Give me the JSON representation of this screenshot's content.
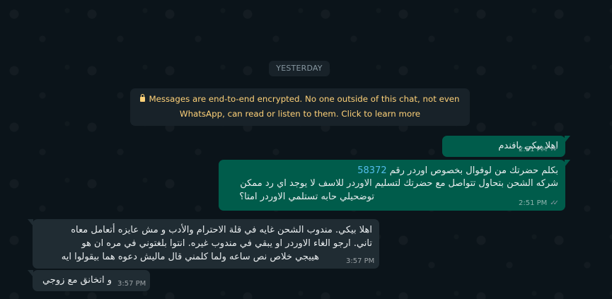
{
  "date_chip": "YESTERDAY",
  "encryption_notice": {
    "line1": "Messages are end-to-end encrypted. No one outside of this chat, not even",
    "line2": "WhatsApp, can read or listen to them. Click to learn more"
  },
  "messages": [
    {
      "direction": "outgoing",
      "text": "اهلا بيكي يافندم",
      "time": "2:51 PM",
      "status": "read"
    },
    {
      "direction": "outgoing",
      "line1_prefix": "بكلم حضرتك من لوفوال بخصوص اوردر رقم",
      "order_number": "58372",
      "line2": "شركه الشحن بتحاول تتواصل مع حضرتك لتسليم الاوردر للاسف لا يوجد اي رد ممكن",
      "line3": "توضحيلي حابه تستلمي الاوردر امتا؟",
      "time": "2:51 PM",
      "status": "read"
    },
    {
      "direction": "incoming",
      "line1": "اهلا بيكي. مندوب الشحن غايه في قلة الاحترام والأدب و مش عايزه أتعامل معاه",
      "line2": "تاني. ارجو الغاء الاوردر او يبقي في مندوب غيره. انتوا بلغتوني في مره ان هو",
      "line3": "هييجي خلاص نص ساعه ولما كلمني قال ماليش دعوه هما بيقولوا ايه",
      "time": "3:57 PM"
    },
    {
      "direction": "incoming",
      "text": "و اتخانق مع زوجي",
      "time": "3:57 PM"
    }
  ],
  "colors": {
    "background": "#0b141a",
    "outgoing_bubble": "#005c4b",
    "incoming_bubble": "#202c33",
    "notice_text": "#ffd279",
    "read_ticks": "#8696a0"
  }
}
